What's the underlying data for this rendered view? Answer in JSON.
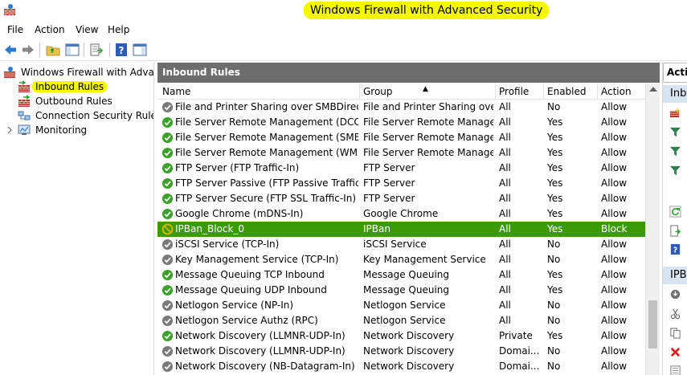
{
  "window": {
    "title": "Windows Firewall with Advanced Security"
  },
  "menu": {
    "items": [
      "File",
      "Action",
      "View",
      "Help"
    ]
  },
  "tree": {
    "root": "Windows Firewall with Advance",
    "items": [
      "Inbound Rules",
      "Outbound Rules",
      "Connection Security Rules",
      "Monitoring"
    ]
  },
  "center": {
    "header": "Inbound Rules",
    "columns": {
      "name": "Name",
      "group": "Group",
      "profile": "Profile",
      "enabled": "Enabled",
      "action": "Action"
    },
    "rows": [
      {
        "name": "File and Printer Sharing over SMBDirect (i...",
        "group": "File and Printer Sharing over...",
        "profile": "All",
        "enabled": "No",
        "action": "Allow",
        "status": "disabled"
      },
      {
        "name": "File Server Remote Management (DCOM...",
        "group": "File Server Remote Manage...",
        "profile": "All",
        "enabled": "Yes",
        "action": "Allow",
        "status": "allow"
      },
      {
        "name": "File Server Remote Management (SMB-In)",
        "group": "File Server Remote Manage...",
        "profile": "All",
        "enabled": "Yes",
        "action": "Allow",
        "status": "allow"
      },
      {
        "name": "File Server Remote Management (WMI-In)",
        "group": "File Server Remote Manage...",
        "profile": "All",
        "enabled": "Yes",
        "action": "Allow",
        "status": "allow"
      },
      {
        "name": "FTP Server (FTP Traffic-In)",
        "group": "FTP Server",
        "profile": "All",
        "enabled": "Yes",
        "action": "Allow",
        "status": "allow"
      },
      {
        "name": "FTP Server Passive (FTP Passive Traffic-In)",
        "group": "FTP Server",
        "profile": "All",
        "enabled": "Yes",
        "action": "Allow",
        "status": "allow"
      },
      {
        "name": "FTP Server Secure (FTP SSL Traffic-In)",
        "group": "FTP Server",
        "profile": "All",
        "enabled": "Yes",
        "action": "Allow",
        "status": "allow"
      },
      {
        "name": "Google Chrome (mDNS-In)",
        "group": "Google Chrome",
        "profile": "All",
        "enabled": "Yes",
        "action": "Allow",
        "status": "allow"
      },
      {
        "name": "IPBan_Block_0",
        "group": "IPBan",
        "profile": "All",
        "enabled": "Yes",
        "action": "Block",
        "status": "block"
      },
      {
        "name": "iSCSI Service (TCP-In)",
        "group": "iSCSI Service",
        "profile": "All",
        "enabled": "No",
        "action": "Allow",
        "status": "disabled"
      },
      {
        "name": "Key Management Service (TCP-In)",
        "group": "Key Management Service",
        "profile": "All",
        "enabled": "No",
        "action": "Allow",
        "status": "disabled"
      },
      {
        "name": "Message Queuing TCP Inbound",
        "group": "Message Queuing",
        "profile": "All",
        "enabled": "Yes",
        "action": "Allow",
        "status": "allow"
      },
      {
        "name": "Message Queuing UDP Inbound",
        "group": "Message Queuing",
        "profile": "All",
        "enabled": "Yes",
        "action": "Allow",
        "status": "allow"
      },
      {
        "name": "Netlogon Service (NP-In)",
        "group": "Netlogon Service",
        "profile": "All",
        "enabled": "No",
        "action": "Allow",
        "status": "disabled"
      },
      {
        "name": "Netlogon Service Authz (RPC)",
        "group": "Netlogon Service",
        "profile": "All",
        "enabled": "No",
        "action": "Allow",
        "status": "disabled"
      },
      {
        "name": "Network Discovery (LLMNR-UDP-In)",
        "group": "Network Discovery",
        "profile": "Private",
        "enabled": "Yes",
        "action": "Allow",
        "status": "allow"
      },
      {
        "name": "Network Discovery (LLMNR-UDP-In)",
        "group": "Network Discovery",
        "profile": "Domai...",
        "enabled": "No",
        "action": "Allow",
        "status": "disabled"
      },
      {
        "name": "Network Discovery (NB-Datagram-In)",
        "group": "Network Discovery",
        "profile": "Domai...",
        "enabled": "No",
        "action": "Allow",
        "status": "disabled"
      }
    ]
  },
  "actions": {
    "header": "Actio",
    "sub1": "Inbo",
    "sub2": "IPBa"
  },
  "colors": {
    "selected_row": "#3a9a08",
    "highlight": "#f4f700",
    "allow_icon": "#3ca12a",
    "disabled_icon": "#7a7a7a",
    "block_icon": "#d6b800"
  }
}
